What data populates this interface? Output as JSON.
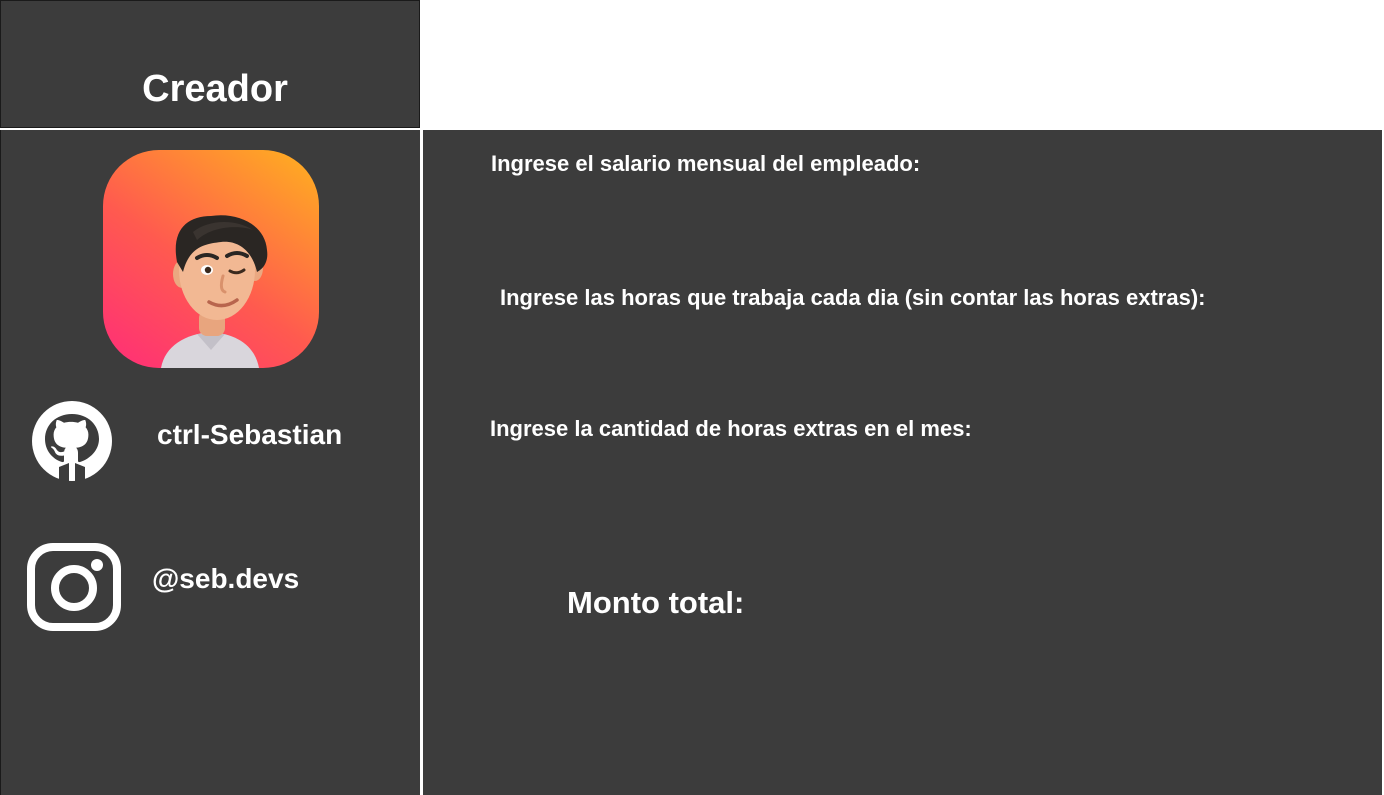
{
  "sidebar": {
    "title": "Creador",
    "avatar_icon": "memoji-avatar",
    "github": {
      "icon": "github-icon",
      "username": "ctrl-Sebastian"
    },
    "instagram": {
      "icon": "instagram-icon",
      "handle": "@seb.devs"
    }
  },
  "form": {
    "salary_label": "Ingrese el salario mensual del empleado:",
    "hours_label": "Ingrese las horas que trabaja cada dia (sin contar las horas extras):",
    "extra_hours_label": "Ingrese la cantidad de horas extras en el mes:",
    "total_label": "Monto total:"
  },
  "colors": {
    "panel_bg": "#3c3c3c",
    "text": "#ffffff",
    "avatar_gradient": [
      "#ff2d78",
      "#ff5a4f",
      "#ffb21e"
    ]
  }
}
